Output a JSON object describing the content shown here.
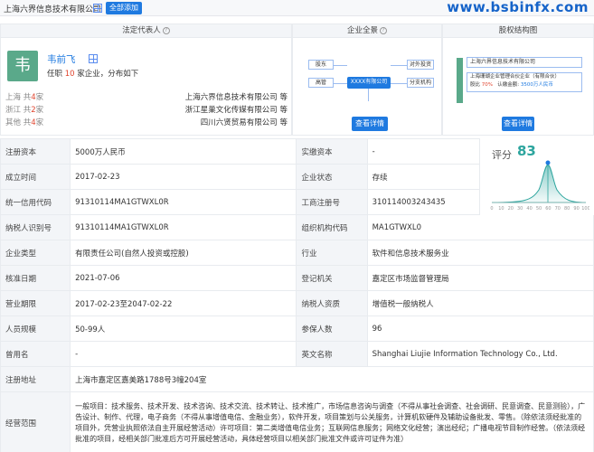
{
  "header": {
    "company_name": "上海六界信息技术有限公司",
    "add_button": "全部添加",
    "watermark": "www.bsbinfx.com"
  },
  "legal_rep": {
    "title": "法定代表人",
    "avatar_char": "韦",
    "name": "韦前飞",
    "desc_prefix": "任职",
    "desc_count": "10",
    "desc_suffix": "家企业，分布如下",
    "regions": [
      {
        "name": "上海",
        "prefix": "共",
        "count": "4",
        "unit": "家",
        "company": "上海六界信息技术有限公司 等"
      },
      {
        "name": "浙江",
        "prefix": "共",
        "count": "2",
        "unit": "家",
        "company": "浙江星巢文化传媒有限公司 等"
      },
      {
        "name": "其他",
        "prefix": "共",
        "count": "4",
        "unit": "家",
        "company": "四川六贤贸易有限公司 等"
      }
    ]
  },
  "full_view": {
    "title": "企业全景",
    "nodes": {
      "shareholder": "股东",
      "executive": "高管",
      "center": "XXXX有限公司",
      "invest": "对外投资",
      "branch": "分支机构"
    },
    "detail_button": "查看详情"
  },
  "equity": {
    "title": "股权结构图",
    "top_company": "上海六界信息技术有限公司",
    "sub_company": "上海珊瑚企业管理合伙企业（有限合伙）",
    "ratio_label": "股比",
    "ratio_value": "70%",
    "capital_label": "认缴金额",
    "capital_value": "3500万人民币",
    "detail_button": "查看详情"
  },
  "score": {
    "label": "评分",
    "value": "83"
  },
  "score_chart": {
    "ticks": [
      "0",
      "10",
      "20",
      "30",
      "40",
      "50",
      "60",
      "70",
      "80",
      "90",
      "100"
    ]
  },
  "info": {
    "reg_capital_label": "注册资本",
    "reg_capital": "5000万人民币",
    "paid_capital_label": "实缴资本",
    "paid_capital": "-",
    "founded_label": "成立时间",
    "founded": "2017-02-23",
    "status_label": "企业状态",
    "status": "存续",
    "credit_code_label": "统一信用代码",
    "credit_code": "91310114MA1GTWXL0R",
    "reg_no_label": "工商注册号",
    "reg_no": "310114003243435",
    "taxpayer_id_label": "纳税人识别号",
    "taxpayer_id": "91310114MA1GTWXL0R",
    "org_code_label": "组织机构代码",
    "org_code": "MA1GTWXL0",
    "type_label": "企业类型",
    "type": "有限责任公司(自然人投资或控股)",
    "industry_label": "行业",
    "industry": "软件和信息技术服务业",
    "approval_date_label": "核准日期",
    "approval_date": "2021-07-06",
    "authority_label": "登记机关",
    "authority": "嘉定区市场监督管理局",
    "period_label": "营业期限",
    "period": "2017-02-23至2047-02-22",
    "taxpayer_qual_label": "纳税人资质",
    "taxpayer_qual": "增值税一般纳税人",
    "staff_label": "人员规模",
    "staff": "50-99人",
    "insured_label": "参保人数",
    "insured": "96",
    "former_name_label": "曾用名",
    "former_name": "-",
    "english_name_label": "英文名称",
    "english_name": "Shanghai Liujie Information Technology Co., Ltd.",
    "address_label": "注册地址",
    "address": "上海市嘉定区嘉美路1788号3幢204室",
    "scope_label": "经营范围",
    "scope": "一般项目：技术服务、技术开发、技术咨询、技术交流、技术转让、技术推广，市场信息咨询与调查（不得从事社会调查、社会调研、民意调查、民意测验），广告设计、制作、代理，电子商务（不得从事增值电信、金融业务），软件开发，项目策划与公关服务，计算机软硬件及辅助设备批发、零售。（除依法须经批准的项目外，凭营业执照依法自主开展经营活动）许可项目：第二类增值电信业务；互联网信息服务；网络文化经营；演出经纪；广播电视节目制作经营。（依法须经批准的项目，经相关部门批准后方可开展经营活动，具体经营项目以相关部门批准文件或许可证件为准）"
  }
}
